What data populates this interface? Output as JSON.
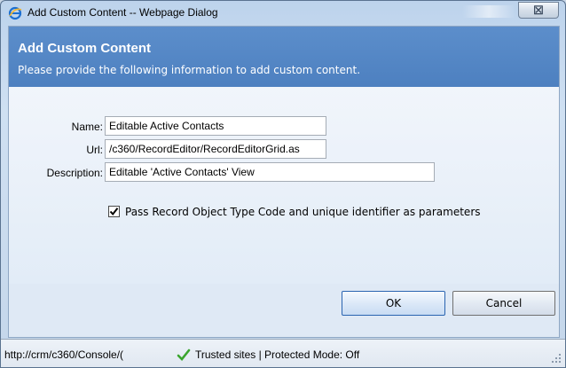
{
  "window": {
    "title": "Add Custom Content -- Webpage Dialog",
    "close_glyph": "☒"
  },
  "header": {
    "title": "Add Custom Content",
    "subtitle": "Please provide the following information to add custom content."
  },
  "form": {
    "name_label": "Name:",
    "name_value": "Editable Active Contacts",
    "url_label": "Url:",
    "url_value": "/c360/RecordEditor/RecordEditorGrid.as",
    "description_label": "Description:",
    "description_value": "Editable 'Active Contacts' View",
    "pass_params_checked": true,
    "pass_params_label": "Pass Record Object Type Code and unique identifier as parameters"
  },
  "buttons": {
    "ok": "OK",
    "cancel": "Cancel"
  },
  "statusbar": {
    "url": "http://crm/c360/Console/(",
    "zone": "Trusted sites | Protected Mode: Off"
  },
  "icons": {
    "browser": "ie-icon",
    "close": "close-icon",
    "checkbox": "checkmark-icon",
    "zone": "green-checkmark-icon"
  },
  "colors": {
    "header_band": "#4d80c0",
    "button_border": "#2a64b0",
    "zone_check": "#3aa52e"
  }
}
